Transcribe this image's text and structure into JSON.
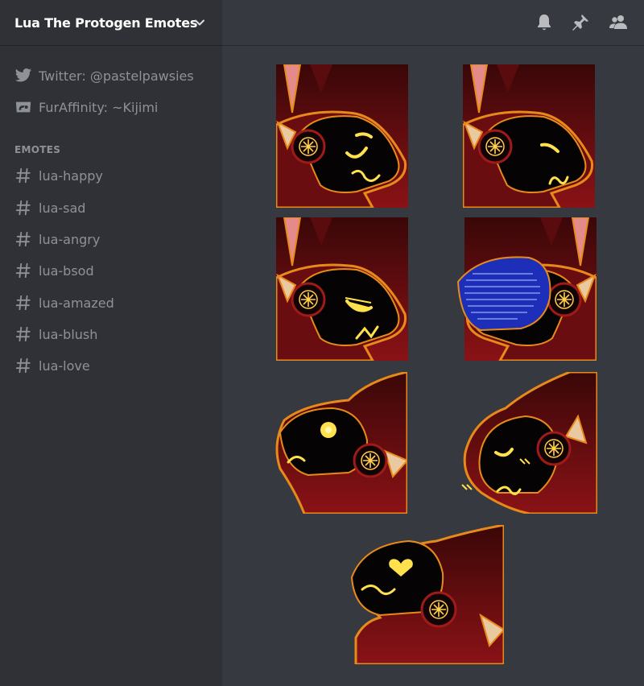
{
  "server": {
    "name": "Lua The Protogen Emotes"
  },
  "links": [
    {
      "label": "Twitter: @pastelpawsies",
      "icon": "twitter-icon"
    },
    {
      "label": "FurAffinity: ~Kijimi",
      "icon": "furaffinity-icon"
    }
  ],
  "category": {
    "label": "EMOTES"
  },
  "channels": [
    {
      "label": "lua-happy"
    },
    {
      "label": "lua-sad"
    },
    {
      "label": "lua-angry"
    },
    {
      "label": "lua-bsod"
    },
    {
      "label": "lua-amazed"
    },
    {
      "label": "lua-blush"
    },
    {
      "label": "lua-love"
    }
  ],
  "toolbar": {
    "icons": [
      "bell-icon",
      "pin-icon",
      "members-icon"
    ]
  },
  "emotes": [
    {
      "name": "lua-happy",
      "expression": "happy",
      "facing": "right"
    },
    {
      "name": "lua-sad",
      "expression": "sad",
      "facing": "right"
    },
    {
      "name": "lua-angry",
      "expression": "angry",
      "facing": "right"
    },
    {
      "name": "lua-bsod",
      "expression": "bsod",
      "facing": "left"
    },
    {
      "name": "lua-amazed",
      "expression": "amazed",
      "facing": "left"
    },
    {
      "name": "lua-blush",
      "expression": "blush",
      "facing": "left"
    },
    {
      "name": "lua-love",
      "expression": "love",
      "facing": "left"
    }
  ],
  "colors": {
    "sidebar_bg": "#2f3136",
    "main_bg": "#36393f",
    "muted_text": "#8e9297",
    "visor_glow": "#ffe14d",
    "fur": "#7a0f12",
    "outline": "#e88a1a",
    "bsod_blue": "#1d2fb8"
  }
}
